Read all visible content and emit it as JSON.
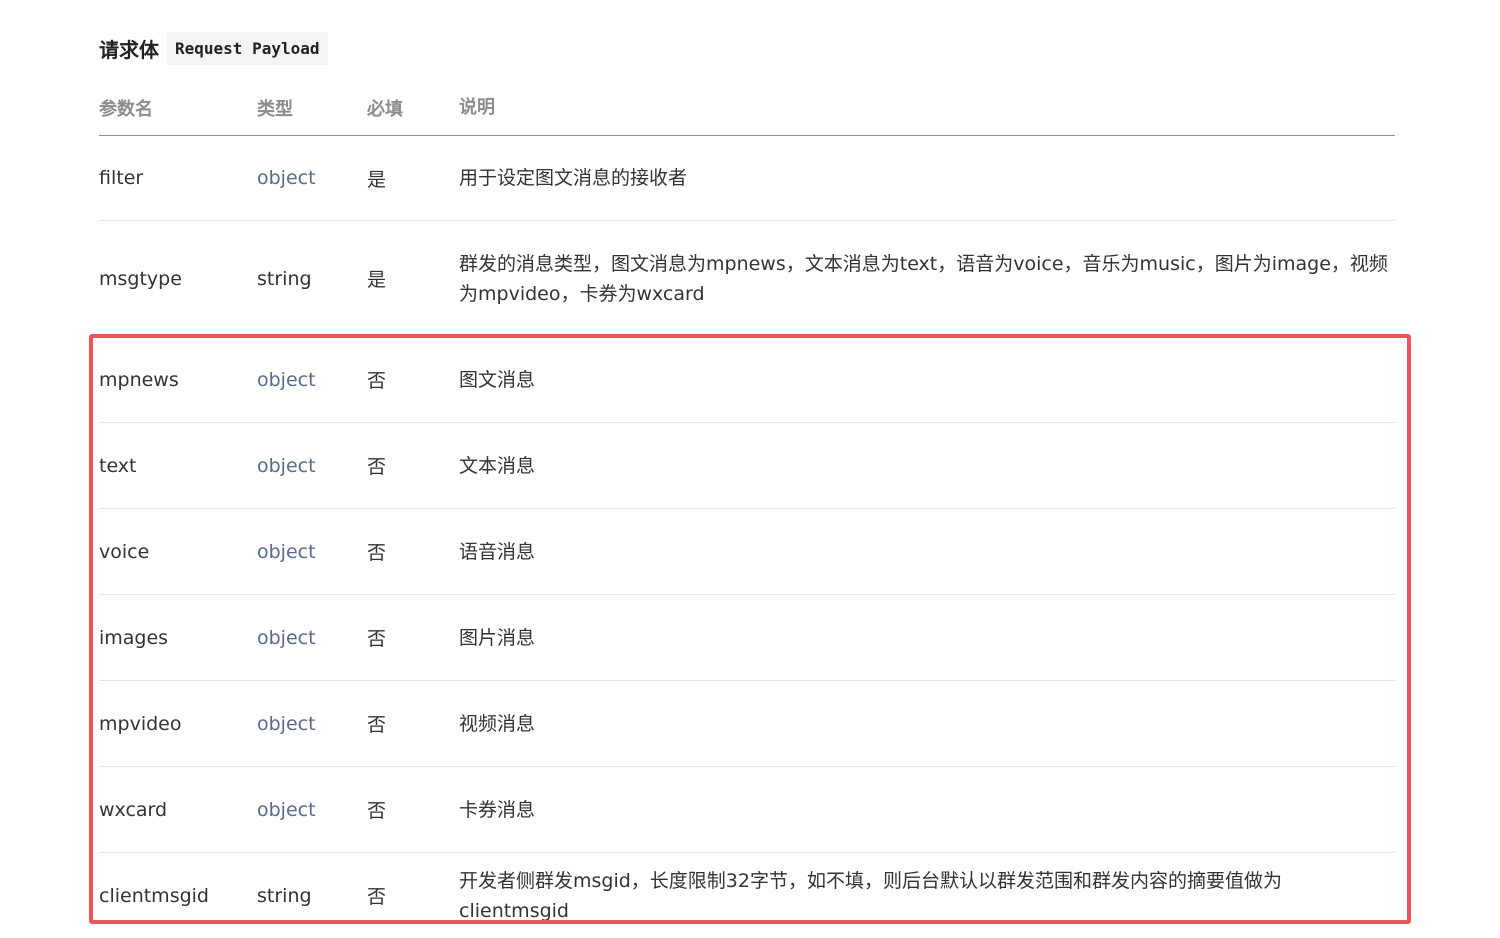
{
  "heading": {
    "title": "请求体",
    "code": "Request Payload"
  },
  "table": {
    "headers": {
      "name": "参数名",
      "type": "类型",
      "required": "必填",
      "description": "说明"
    },
    "rows": [
      {
        "name": "filter",
        "type": "object",
        "required": "是",
        "description": "用于设定图文消息的接收者"
      },
      {
        "name": "msgtype",
        "type": "string",
        "required": "是",
        "description": "群发的消息类型，图文消息为mpnews，文本消息为text，语音为voice，音乐为music，图片为image，视频为mpvideo，卡券为wxcard"
      },
      {
        "name": "mpnews",
        "type": "object",
        "required": "否",
        "description": "图文消息"
      },
      {
        "name": "text",
        "type": "object",
        "required": "否",
        "description": "文本消息"
      },
      {
        "name": "voice",
        "type": "object",
        "required": "否",
        "description": "语音消息"
      },
      {
        "name": "images",
        "type": "object",
        "required": "否",
        "description": "图片消息"
      },
      {
        "name": "mpvideo",
        "type": "object",
        "required": "否",
        "description": "视频消息"
      },
      {
        "name": "wxcard",
        "type": "object",
        "required": "否",
        "description": "卡券消息"
      },
      {
        "name": "clientmsgid",
        "type": "string",
        "required": "否",
        "description": "开发者侧群发msgid，长度限制32字节，如不填，则后台默认以群发范围和群发内容的摘要值做为 clientmsgid"
      }
    ]
  },
  "colors": {
    "link_type": "#586a8c",
    "highlight_border": "#f0545a",
    "header_text": "#8c8c8c"
  }
}
